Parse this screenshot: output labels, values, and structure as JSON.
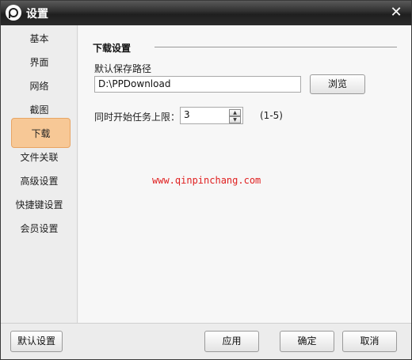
{
  "window": {
    "title": "设置"
  },
  "titlebar": {
    "close_glyph": "✕"
  },
  "sidebar": {
    "items": [
      {
        "label": "基本"
      },
      {
        "label": "界面"
      },
      {
        "label": "网络"
      },
      {
        "label": "截图"
      },
      {
        "label": "下载",
        "active": true
      },
      {
        "label": "文件关联"
      },
      {
        "label": "高级设置"
      },
      {
        "label": "快捷键设置"
      },
      {
        "label": "会员设置"
      }
    ]
  },
  "download": {
    "section_title": "下载设置",
    "path_label": "默认保存路径",
    "path_value": "D:\\PPDownload",
    "browse_label": "浏览",
    "limit_label": "同时开始任务上限：",
    "limit_value": "3",
    "range_text": "(1-5)"
  },
  "watermark": "www.qinpinchang.com",
  "footer": {
    "default_label": "默认设置",
    "apply_label": "应用",
    "ok_label": "确定",
    "cancel_label": "取消"
  },
  "colors": {
    "active_tab_bg": "#f7c896",
    "active_tab_border": "#e8a564",
    "watermark": "#e02020",
    "titlebar": "#2b2b2b"
  }
}
